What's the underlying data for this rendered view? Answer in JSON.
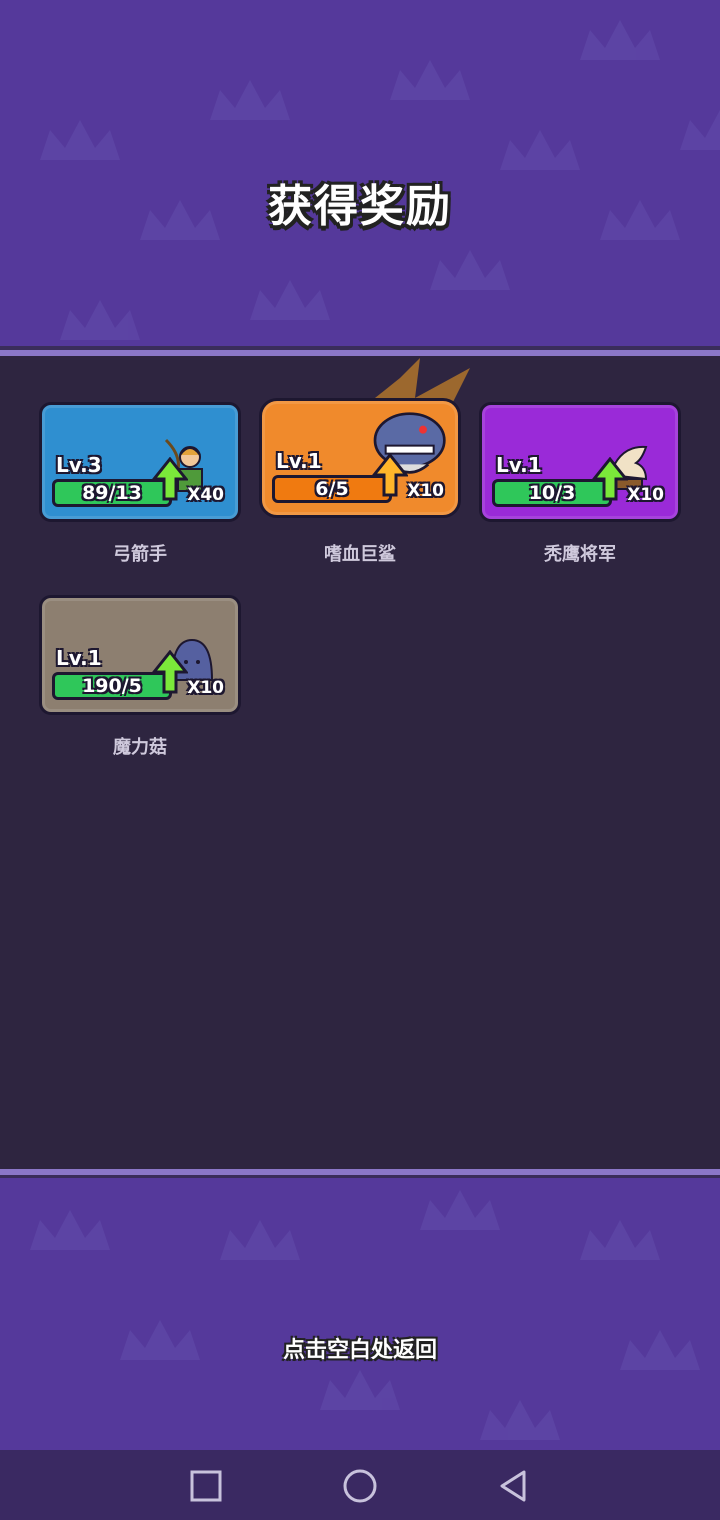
{
  "title": "获得奖励",
  "cards": [
    {
      "level": "Lv.3",
      "progress": "89/13",
      "count": "X40",
      "name": "弓箭手",
      "color": "#2f8fd0",
      "bar_color": "#2fc75a",
      "icon": "archer-character-icon"
    },
    {
      "level": "Lv.1",
      "progress": "6/5",
      "count": "X10",
      "name": "嗜血巨鲨",
      "color": "#f08a2c",
      "bar_color": "#f07a10",
      "icon": "shark-character-icon"
    },
    {
      "level": "Lv.1",
      "progress": "10/3",
      "count": "X10",
      "name": "秃鹰将军",
      "color": "#9a2ad8",
      "bar_color": "#2fc75a",
      "icon": "vulture-general-character-icon"
    },
    {
      "level": "Lv.1",
      "progress": "190/5",
      "count": "X10",
      "name": "魔力菇",
      "color": "#8d7f70",
      "bar_color": "#2fc75a",
      "icon": "magic-mushroom-character-icon"
    }
  ],
  "hint": "点击空白处返回",
  "nav": {
    "recent": "square-icon",
    "home": "circle-icon",
    "back": "triangle-back-icon"
  }
}
